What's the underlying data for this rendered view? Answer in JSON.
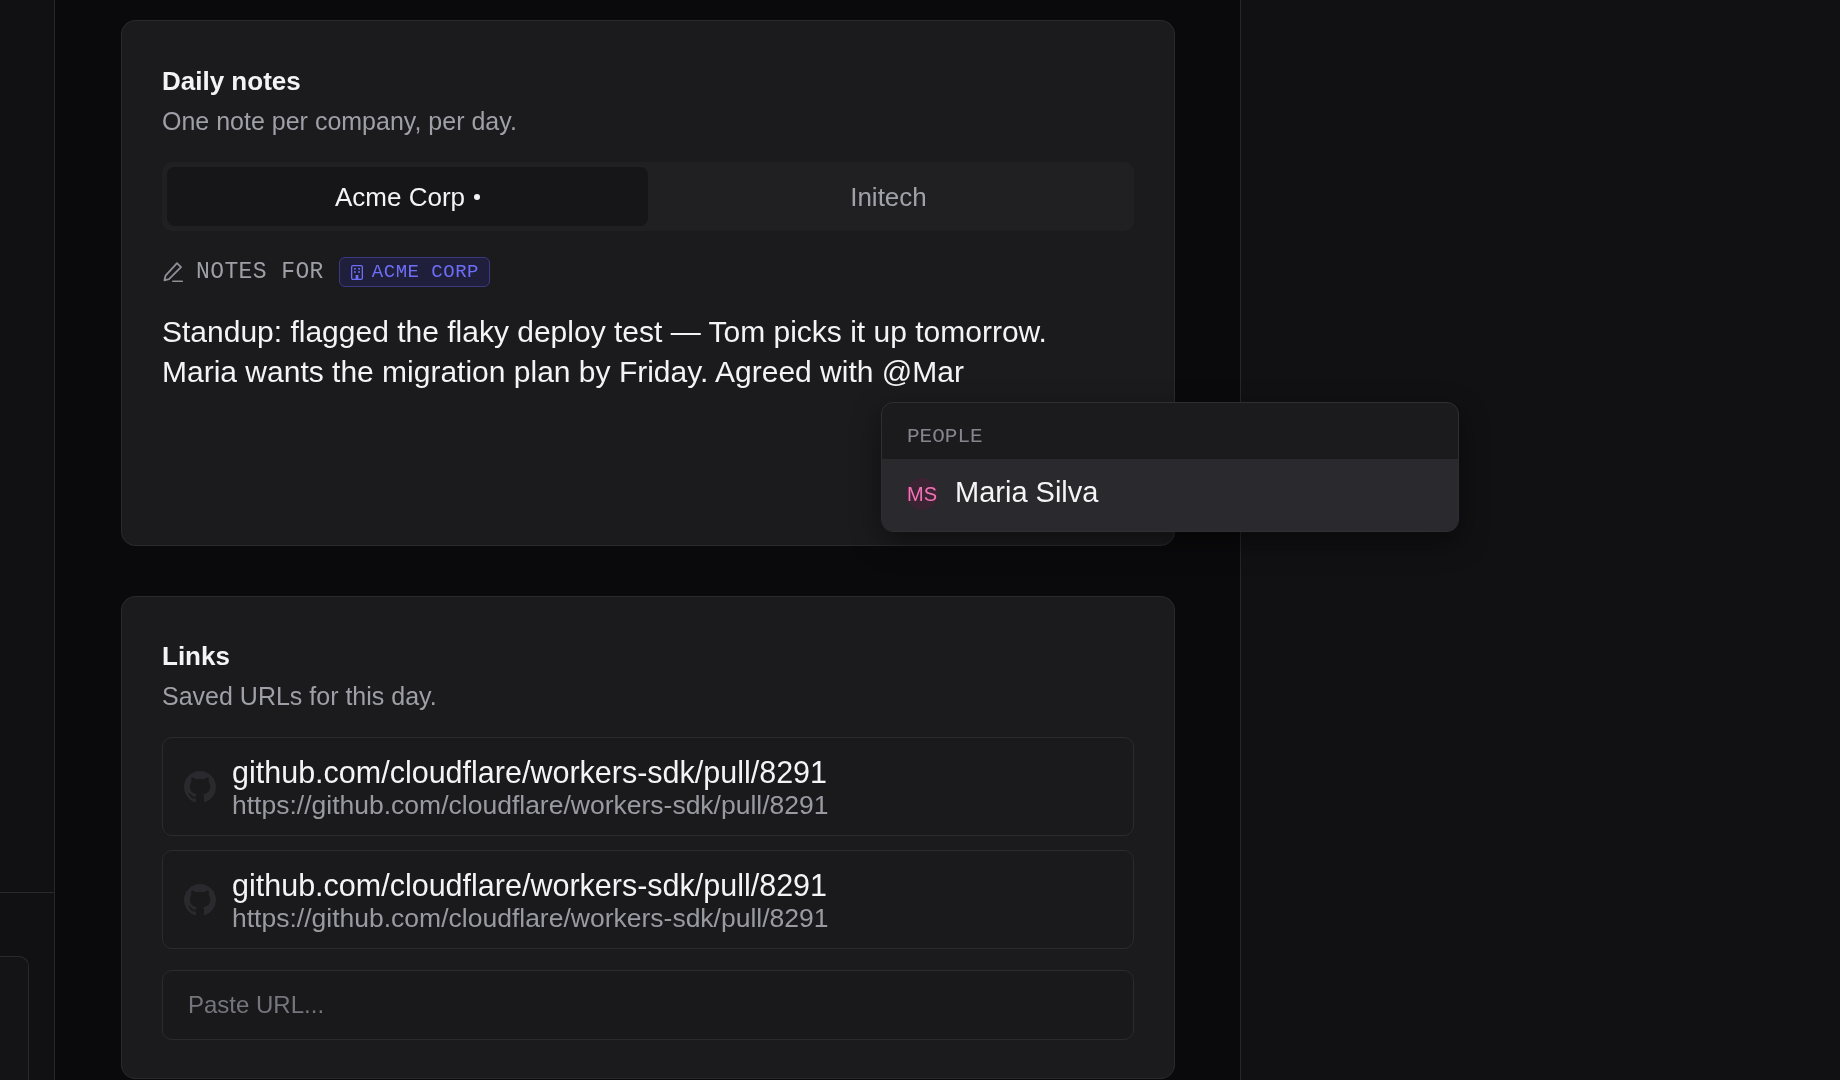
{
  "daily_notes": {
    "title": "Daily notes",
    "subtitle": "One note per company, per day.",
    "tabs": [
      {
        "label": "Acme Corp",
        "has_note": true,
        "selected": true
      },
      {
        "label": "Initech",
        "has_note": false,
        "selected": false
      }
    ],
    "notes_for": {
      "label": "NOTES FOR",
      "company": "ACME CORP"
    },
    "note": {
      "value": "Standup: flagged the flaky deploy test — Tom picks it up tomorrow. Maria wants the migration plan by Friday. Agreed with @Mar"
    },
    "mention_menu": {
      "heading": "PEOPLE",
      "items": [
        {
          "initials": "MS",
          "name": "Maria Silva",
          "selected": true
        }
      ]
    }
  },
  "links": {
    "title": "Links",
    "subtitle": "Saved URLs for this day.",
    "items": [
      {
        "title": "github.com/cloudflare/workers-sdk/pull/8291",
        "url": "https://github.com/cloudflare/workers-sdk/pull/8291"
      },
      {
        "title": "github.com/cloudflare/workers-sdk/pull/8291",
        "url": "https://github.com/cloudflare/workers-sdk/pull/8291"
      }
    ],
    "input": {
      "placeholder": "Paste URL..."
    }
  }
}
